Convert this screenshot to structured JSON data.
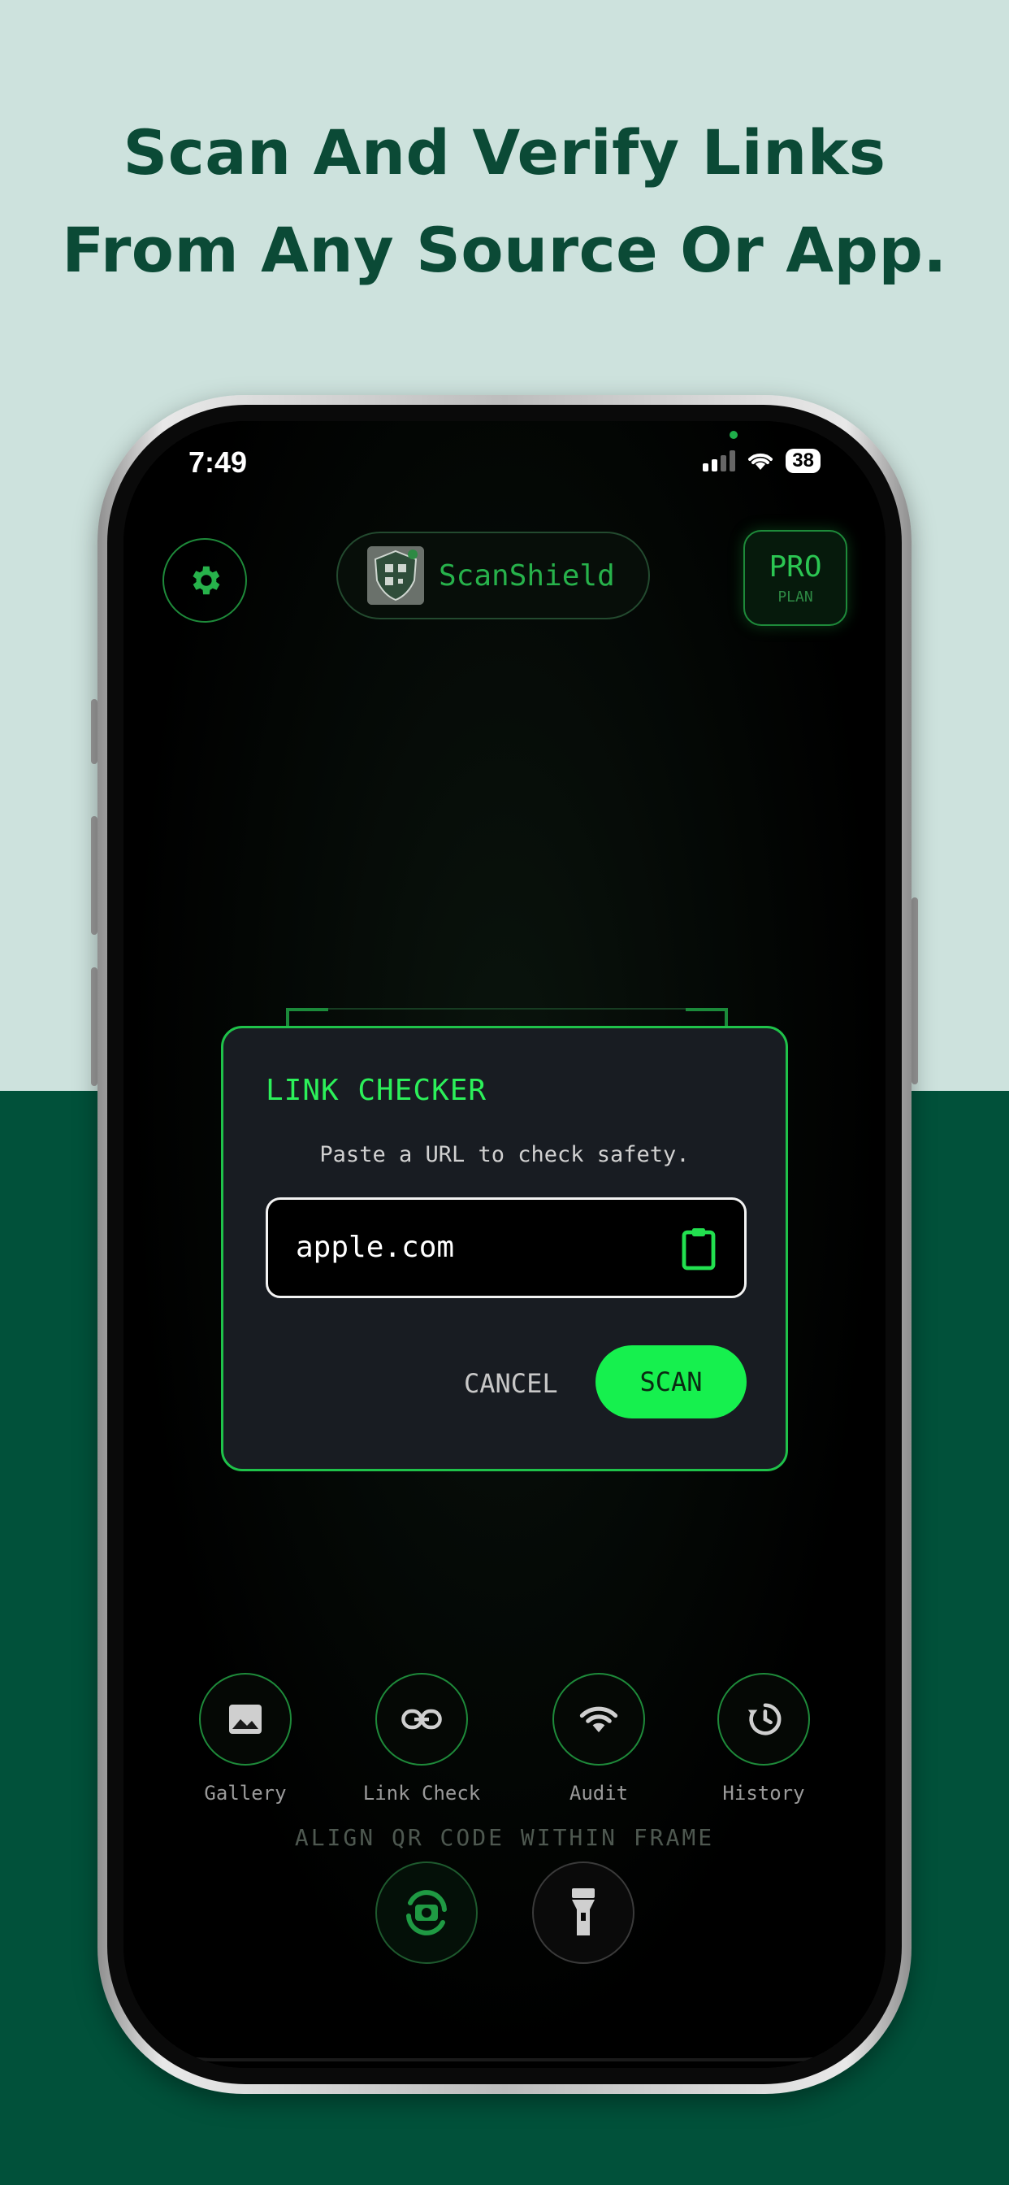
{
  "headline": {
    "line1": "Scan And Verify Links",
    "line2": "From Any Source Or App."
  },
  "status_bar": {
    "time": "7:49",
    "battery": "38"
  },
  "header": {
    "app_name": "ScanShield",
    "pro_label": "PRO",
    "pro_sub": "PLAN"
  },
  "dialog": {
    "title": "LINK CHECKER",
    "subtitle": "Paste a URL to check safety.",
    "url_value": "apple.com",
    "cancel_label": "CANCEL",
    "scan_label": "SCAN"
  },
  "tools": [
    {
      "label": "Gallery",
      "icon": "image-icon"
    },
    {
      "label": "Link Check",
      "icon": "link-icon"
    },
    {
      "label": "Audit",
      "icon": "wifi-icon"
    },
    {
      "label": "History",
      "icon": "history-icon"
    }
  ],
  "hint": "ALIGN QR CODE WITHIN FRAME",
  "colors": {
    "accent": "#16f04e",
    "brand_green": "#27b24b",
    "bg_top": "#cde2dd",
    "bg_bottom": "#01513a"
  }
}
